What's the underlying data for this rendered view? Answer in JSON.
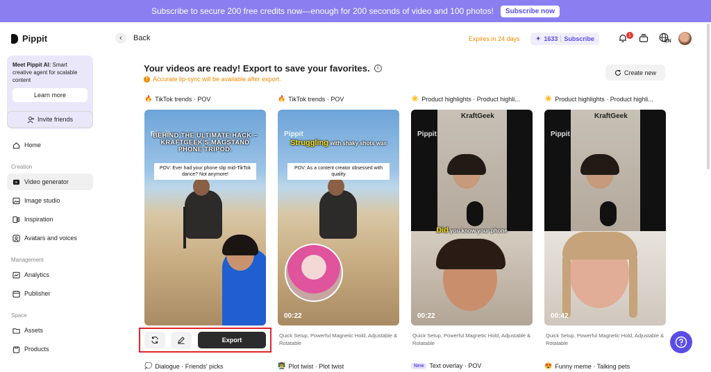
{
  "banner": {
    "text": "Subscribe to secure 200 free credits now—enough for 200 seconds of video and 100 photos!",
    "button": "Subscribe now"
  },
  "sidebar": {
    "logo": "Pippit",
    "promo_bold": "Meet Pippit AI:",
    "promo_text": " Smart creative agent for scalable content",
    "learn_more": "Learn more",
    "invite": "Invite friends",
    "home": "Home",
    "creation_label": "Creation",
    "creation": [
      "Video generator",
      "Image studio",
      "Inspiration",
      "Avatars and voices"
    ],
    "management_label": "Management",
    "management": [
      "Analytics",
      "Publisher"
    ],
    "space_label": "Space",
    "space": [
      "Assets",
      "Products"
    ]
  },
  "header": {
    "back": "Back",
    "expires": "Expires in 24 days",
    "credits": "1633",
    "subscribe": "Subscribe",
    "notifications": "1",
    "language": "EN"
  },
  "main": {
    "headline": "Your videos are ready! Export to save your favorites.",
    "warning": "Accurate lip-sync will be available after export.",
    "create_new": "Create new"
  },
  "cards": [
    {
      "title_emoji": "🔥",
      "title": "TikTok trends · POV",
      "caption_top": "BEHIND THE ULTIMATE HACK – KRAFTGEEK'S MAGSTAND PHONE TRIPOD.",
      "caption_box": "POV: Ever had your phone slip mid-TikTok dance? Not anymore!",
      "watermark": "Pippit"
    },
    {
      "title_emoji": "🔥",
      "title": "TikTok trends · POV",
      "caption_yellow": "Struggling",
      "caption_white": " with shaky shots was",
      "caption_box": "POV: As a content creator obsessed with quality",
      "watermark": "Pippit",
      "duration": "00:22",
      "desc": "Quick Setup, Powerful Magnetic Hold, Adjustable & Rotatable"
    },
    {
      "title_emoji": "☀️",
      "title": "Product highlights · Product highli...",
      "brand": "KraftGeek",
      "watermark": "Pippit",
      "caption_yellow": "Did",
      "caption_white": " you know your phone",
      "duration": "00:22",
      "desc": "Quick Setup, Powerful Magnetic Hold, Adjustable & Rotatable"
    },
    {
      "title_emoji": "☀️",
      "title": "Product highlights · Product highli...",
      "brand": "KraftGeek",
      "watermark": "Pippit",
      "duration": "00:42",
      "desc": "Quick Setup, Powerful Magnetic Hold, Adjustable & Rotatable"
    }
  ],
  "actions": {
    "export": "Export"
  },
  "bottom_row": [
    {
      "emoji": "💭",
      "title": "Dialogue · Friends' picks"
    },
    {
      "emoji": "👨‍🏫",
      "title": "Plot twist · Plot twist"
    },
    {
      "tag": "New",
      "title": "Text overlay · POV"
    },
    {
      "emoji": "😍",
      "title": "Funny meme · Talking pets"
    }
  ],
  "colors": {
    "brand": "#5a4de6",
    "banner": "#8a7ef0",
    "warning": "#f28b00",
    "highlight_border": "#e0242b"
  }
}
